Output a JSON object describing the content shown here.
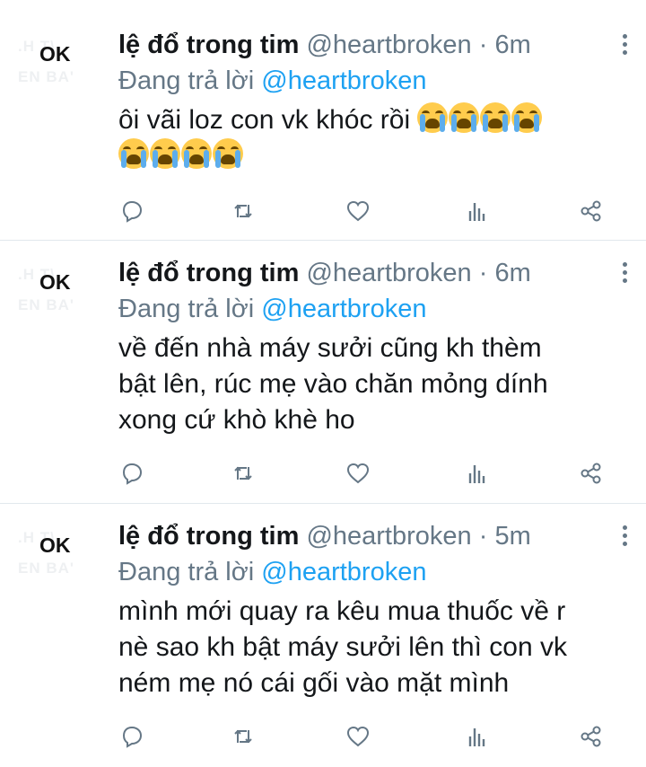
{
  "tweets": [
    {
      "avatar_text": "OK",
      "avatar_ghost_1": ".H   T\\",
      "avatar_ghost_2": "EN BA'",
      "name": "lệ đổ trong tim",
      "handle": "@heartbroken",
      "separator": "·",
      "time": "6m",
      "reply_prefix": "Đang trả lời",
      "reply_mention": "@heartbroken",
      "text": "ôi vãi loz con vk khóc rồi",
      "emoji": "loudly-crying-face",
      "emoji_count": 8
    },
    {
      "avatar_text": "OK",
      "avatar_ghost_1": ".H   T\\",
      "avatar_ghost_2": "EN BA'",
      "name": "lệ đổ trong tim",
      "handle": "@heartbroken",
      "separator": "·",
      "time": "6m",
      "reply_prefix": "Đang trả lời",
      "reply_mention": "@heartbroken",
      "text_lines": [
        "về đến nhà máy sưởi cũng kh thèm",
        "bật lên, rúc mẹ vào chăn mỏng dính",
        "xong cứ khò khè ho"
      ]
    },
    {
      "avatar_text": "OK",
      "avatar_ghost_1": ".H   T\\",
      "avatar_ghost_2": "EN BA'",
      "name": "lệ đổ trong tim",
      "handle": "@heartbroken",
      "separator": "·",
      "time": "5m",
      "reply_prefix": "Đang trả lời",
      "reply_mention": "@heartbroken",
      "text_lines": [
        "mình mới quay ra kêu mua thuốc về r",
        "nè sao kh bật máy sưởi lên thì con vk",
        "ném mẹ nó cái gối vào mặt mình"
      ]
    }
  ],
  "action_icons": [
    "reply-icon",
    "retweet-icon",
    "like-icon",
    "analytics-icon",
    "share-icon"
  ],
  "colors": {
    "text": "#14171a",
    "secondary": "#657786",
    "mention": "#1da1f2",
    "divider": "#e1e8ed"
  }
}
